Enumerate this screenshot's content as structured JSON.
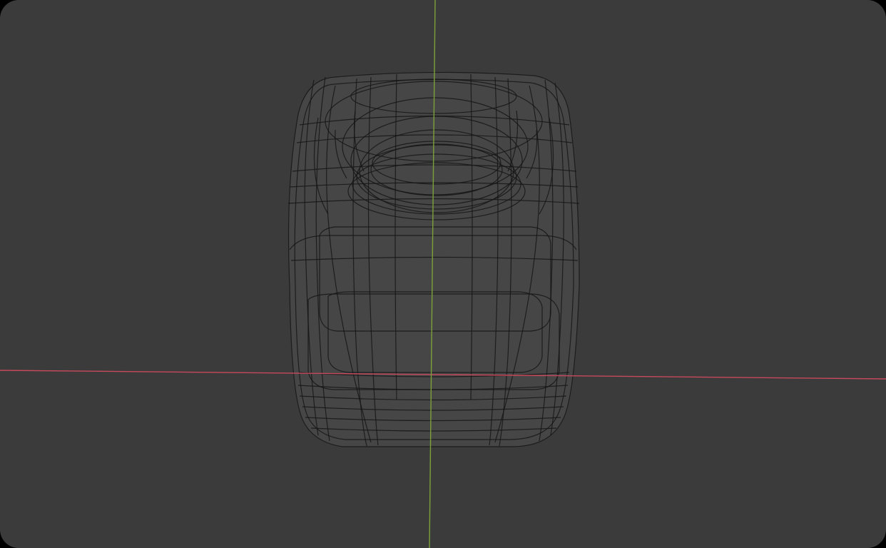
{
  "viewport": {
    "mode": "wireframe",
    "colors": {
      "background": "#3b3b3b",
      "object_fill": "#454545",
      "wire": "#161616",
      "x_axis": "#c7495c",
      "y_axis": "#7da13a"
    }
  },
  "object": {
    "kind": "rounded box container with circular neck"
  }
}
